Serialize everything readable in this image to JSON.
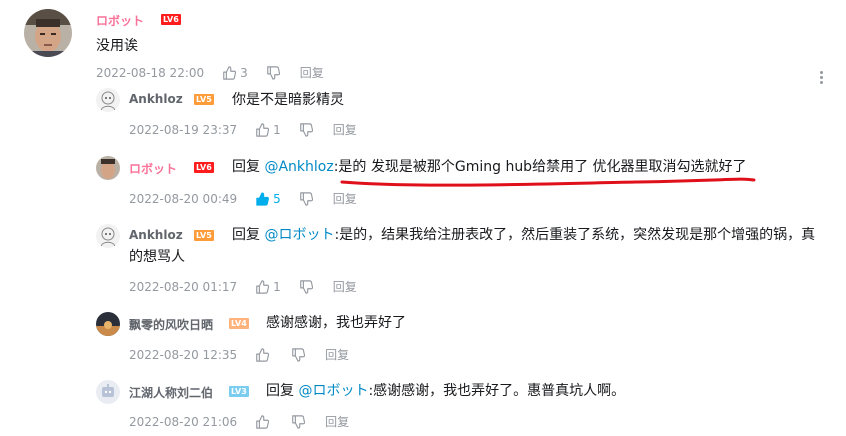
{
  "root": {
    "username": "ロボット",
    "level": "LV6",
    "text": "没用诶",
    "time": "2022-08-18 22:00",
    "likes": "3",
    "reply_label": "回复"
  },
  "replies": [
    {
      "username": "Ankhloz",
      "level": "LV5",
      "text": "你是不是暗影精灵",
      "time": "2022-08-19 23:37",
      "likes": "1",
      "reply_label": "回复"
    },
    {
      "username": "ロボット",
      "level": "LV6",
      "reply_prefix": "回复 ",
      "at": "@Ankhloz",
      "text": ":是的 发现是被那个Gming hub给禁用了 优化器里取消勾选就好了",
      "time": "2022-08-20 00:49",
      "likes": "5",
      "reply_label": "回复"
    },
    {
      "username": "Ankhloz",
      "level": "LV5",
      "reply_prefix": "回复 ",
      "at": "@ロボット",
      "text_line1": ":是的，结果我给注册表改了，然后重装了系统，突然发现是那个增强的锅，真",
      "text_line2": "的想骂人",
      "time": "2022-08-20 01:17",
      "likes": "1",
      "reply_label": "回复"
    },
    {
      "username": "飘零的风吹日晒",
      "level": "LV4",
      "text": "感谢感谢，我也弄好了",
      "time": "2022-08-20 12:35",
      "reply_label": "回复"
    },
    {
      "username": "江湖人称刘二伯",
      "level": "LV3",
      "reply_prefix": "回复 ",
      "at": "@ロボット",
      "text": ":感谢感谢，我也弄好了。惠普真坑人啊。",
      "time": "2022-08-20 21:06",
      "reply_label": "回复"
    }
  ],
  "colors": {
    "vip_name": "#fb7299",
    "at_link": "#008ac5",
    "meta": "#9499a0",
    "liked": "#00aeec",
    "annotation": "#e0101a"
  },
  "icons": [
    "thumbs-up-icon",
    "thumbs-down-icon",
    "more-icon"
  ]
}
